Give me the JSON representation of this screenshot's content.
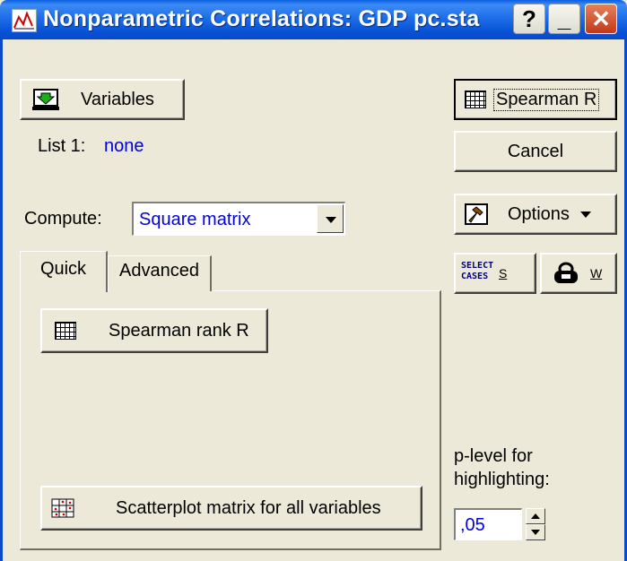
{
  "window": {
    "title": "Nonparametric Correlations: GDP pc.sta",
    "help_button": "?",
    "minimize_button": "_",
    "close_button": "✕"
  },
  "variables": {
    "button_label": "Variables",
    "list_label": "List 1:",
    "list_value": "none"
  },
  "compute": {
    "label": "Compute:",
    "selected": "Square matrix"
  },
  "tabs": [
    {
      "label": "Quick"
    },
    {
      "label": "Advanced"
    }
  ],
  "quick": {
    "spearman_rank_label": "Spearman rank R",
    "scatterplot_label": "Scatterplot matrix for all variables"
  },
  "actions": {
    "spearman_label": "Spearman R",
    "cancel_label": "Cancel",
    "options_label": "Options",
    "select_cases_icon_text": "SELECT CASES",
    "select_cases_key": "S",
    "weight_key": "W"
  },
  "plevel": {
    "label_line1": "p-level for",
    "label_line2": "highlighting:",
    "value": ",05"
  },
  "colors": {
    "titlebar": "#0a5fe0",
    "face": "#ece9d8",
    "value_text": "#0000e0"
  }
}
